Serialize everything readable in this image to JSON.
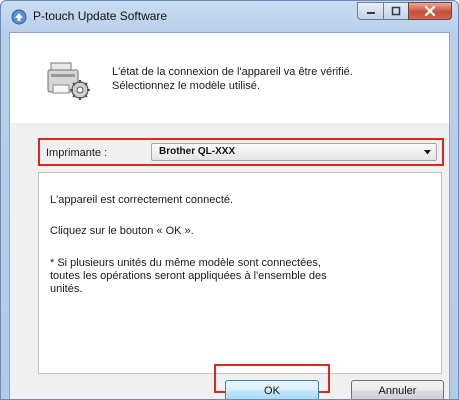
{
  "window": {
    "title": "P-touch Update Software",
    "buttons": [
      "minimize",
      "maximize",
      "close"
    ]
  },
  "header": {
    "line1": "L'état de la connexion de l'appareil va être vérifié.",
    "line2": "Sélectionnez le modèle utilisé.",
    "icon": "printer-settings-icon"
  },
  "printer_select": {
    "label": "Imprimante :",
    "value": "Brother QL-XXX"
  },
  "info": {
    "connected": "L'appareil est correctement connecté.",
    "click_ok": "Cliquez sur le bouton « OK ».",
    "note_line1": "* Si plusieurs unités du même modèle sont connectées,",
    "note_line2": "toutes les opérations seront appliquées à l'ensemble des",
    "note_line3": "unités."
  },
  "buttons": {
    "ok": "OK",
    "cancel": "Annuler"
  },
  "colors": {
    "highlight": "#d9281f",
    "title_bar": "#b9d0ec"
  }
}
